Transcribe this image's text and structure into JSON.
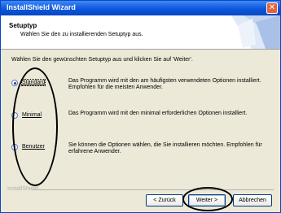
{
  "window": {
    "title": "InstallShield Wizard"
  },
  "header": {
    "title": "Setuptyp",
    "subtitle": "Wählen Sie den zu installierenden Setuptyp aus."
  },
  "instruction": "Wählen Sie den gewünschten Setuptyp aus und klicken Sie auf 'Weiter'.",
  "options": [
    {
      "label": "Standard",
      "selected": true,
      "desc_line1": "Das Programm wird mit den am häufigsten verwendeten Optionen installiert.",
      "desc_line2": "Empfohlen für die meisten Anwender."
    },
    {
      "label": "Minimal",
      "selected": false,
      "desc_line1": "Das Programm wird mit den minimal erforderlichen Optionen installiert.",
      "desc_line2": ""
    },
    {
      "label": "Benutzer",
      "selected": false,
      "desc_line1": "Sie können die Optionen wählen, die Sie installieren möchten. Empfohlen für",
      "desc_line2": "erfahrene Anwender."
    }
  ],
  "footer": {
    "brand": "InstallShield"
  },
  "buttons": {
    "back": "< Zurück",
    "next": "Weiter >",
    "cancel": "Abbrechen"
  },
  "colors": {
    "titlebar": "#0b55d8",
    "dialog": "#ece9d8",
    "annotation": "#000000"
  }
}
